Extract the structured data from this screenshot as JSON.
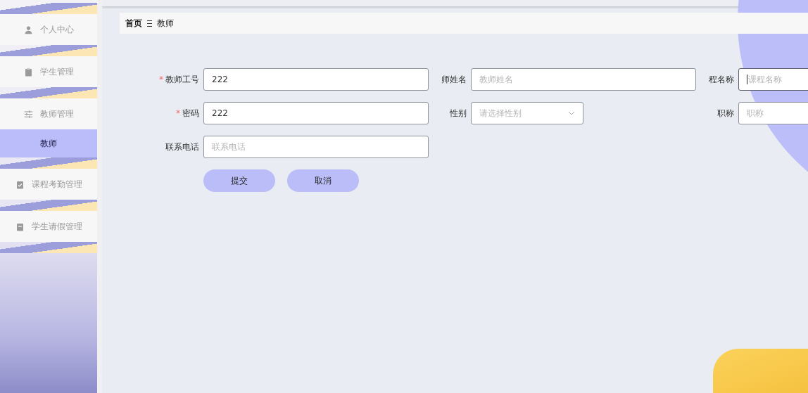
{
  "sidebar": {
    "items": [
      {
        "label": "个人中心",
        "selected": false
      },
      {
        "label": "学生管理",
        "selected": false
      },
      {
        "label": "教师管理",
        "selected": false,
        "children": [
          {
            "label": "教师",
            "selected": true
          }
        ]
      },
      {
        "label": "课程考勤管理",
        "selected": false
      },
      {
        "label": "学生请假管理",
        "selected": false
      }
    ]
  },
  "breadcrumb": [
    "首页",
    "教师"
  ],
  "form": {
    "fields": [
      {
        "kind": "input",
        "mark": "*",
        "label": "教师工号",
        "value": "222",
        "focused": false
      },
      {
        "kind": "input",
        "label": "师姓名",
        "placeholder": "教师姓名",
        "focused": false
      },
      {
        "kind": "input",
        "label": "程名称",
        "placeholder": "课程名称",
        "focused": true
      },
      {
        "kind": "input",
        "mark": "*",
        "label": "密码",
        "value": "222",
        "focused": false
      },
      {
        "kind": "select",
        "label": "性别",
        "placeholder": "请选择性别",
        "focused": false
      },
      {
        "kind": "input",
        "label": "职称",
        "placeholder": "职称",
        "focused": false
      },
      {
        "kind": "input",
        "label": "联系电话",
        "placeholder": "联系电话",
        "focused": false
      }
    ],
    "buttons": [
      "提交",
      "取消"
    ]
  }
}
